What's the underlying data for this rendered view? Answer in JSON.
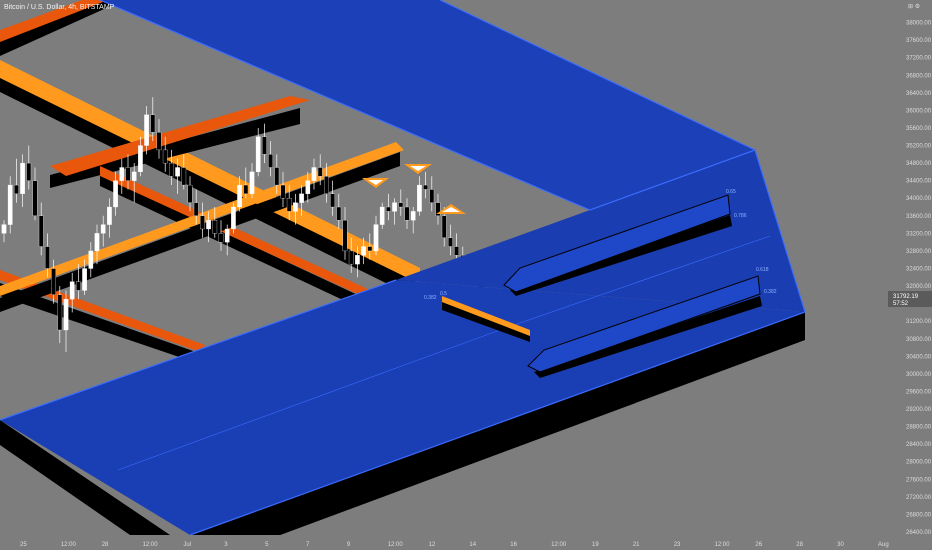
{
  "header": {
    "symbol_title": "Bitcoin / U.S. Dollar, 4h, BITSTAMP",
    "scale_icons": "⊞ ⚙"
  },
  "price_tag": {
    "price": "31792.19",
    "countdown": "57:52"
  },
  "colors": {
    "background": "#7d7d7d",
    "blue_plane": "#1a3fb5",
    "blue_edge": "#3a6cff",
    "orange_light": "#ff9a1f",
    "orange_dark": "#e8570b",
    "shadow": "#000000",
    "candle_up": "#ffffff",
    "candle_down": "#000000"
  },
  "fib_labels": [
    "0.65",
    "0.786",
    "0.618",
    "0.382",
    "0.382",
    "0.5"
  ],
  "icons": [
    "warning-triangle-icon",
    "wedge-arrow-icon"
  ],
  "chart_data": {
    "type": "candlestick",
    "title": "Bitcoin / U.S. Dollar, 4h, BITSTAMP",
    "ylim": [
      26400,
      38400
    ],
    "y_ticks": [
      38000,
      37600,
      37200,
      36800,
      36400,
      36000,
      35600,
      35200,
      34800,
      34400,
      34000,
      33600,
      33200,
      32800,
      32400,
      32000,
      31600,
      31200,
      30800,
      30400,
      30000,
      29600,
      29200,
      28800,
      28400,
      28000,
      27600,
      27200,
      26800,
      26400
    ],
    "x_ticks": [
      "25",
      "12:00",
      "28",
      "12:00",
      "Jul",
      "3",
      "5",
      "7",
      "9",
      "12:00",
      "12",
      "14",
      "16",
      "12:00",
      "19",
      "21",
      "23",
      "12:00",
      "26",
      "28",
      "30",
      "Aug"
    ],
    "last_price": 31792.19,
    "candles": [
      [
        33200,
        33500,
        33000,
        33400
      ],
      [
        33400,
        34500,
        33200,
        34300
      ],
      [
        34300,
        34900,
        33900,
        34100
      ],
      [
        34100,
        35000,
        33800,
        34800
      ],
      [
        34800,
        35200,
        34200,
        34400
      ],
      [
        34400,
        34700,
        33500,
        33600
      ],
      [
        33600,
        33900,
        32700,
        32900
      ],
      [
        32900,
        33200,
        32200,
        32400
      ],
      [
        32400,
        32600,
        31600,
        31800
      ],
      [
        31800,
        32000,
        30700,
        31000
      ],
      [
        31000,
        31900,
        30500,
        31700
      ],
      [
        31700,
        32300,
        31400,
        32100
      ],
      [
        32100,
        32500,
        31700,
        31900
      ],
      [
        31900,
        32600,
        31800,
        32400
      ],
      [
        32400,
        33000,
        32200,
        32800
      ],
      [
        32800,
        33400,
        32500,
        33200
      ],
      [
        33200,
        33600,
        32900,
        33400
      ],
      [
        33400,
        34000,
        33100,
        33800
      ],
      [
        33800,
        34600,
        33600,
        34400
      ],
      [
        34400,
        34900,
        34100,
        34700
      ],
      [
        34700,
        35000,
        34200,
        34400
      ],
      [
        34400,
        34800,
        33900,
        34600
      ],
      [
        34600,
        35400,
        34500,
        35200
      ],
      [
        35200,
        36100,
        35000,
        35900
      ],
      [
        35900,
        36300,
        35300,
        35500
      ],
      [
        35500,
        35800,
        34900,
        35100
      ],
      [
        35100,
        35400,
        34600,
        34800
      ],
      [
        34800,
        35100,
        34300,
        34500
      ],
      [
        34500,
        34900,
        34100,
        34700
      ],
      [
        34700,
        35000,
        34200,
        34300
      ],
      [
        34300,
        34500,
        33700,
        33900
      ],
      [
        33900,
        34200,
        33400,
        33600
      ],
      [
        33600,
        33900,
        33100,
        33300
      ],
      [
        33300,
        33700,
        33000,
        33500
      ],
      [
        33500,
        33800,
        33100,
        33200
      ],
      [
        33200,
        33500,
        32800,
        33000
      ],
      [
        33000,
        33400,
        32700,
        33300
      ],
      [
        33300,
        33900,
        33200,
        33800
      ],
      [
        33800,
        34500,
        33700,
        34300
      ],
      [
        34300,
        34700,
        34000,
        34100
      ],
      [
        34100,
        34800,
        34000,
        34600
      ],
      [
        34600,
        35600,
        34500,
        35400
      ],
      [
        35400,
        35700,
        34800,
        35000
      ],
      [
        35000,
        35300,
        34500,
        34700
      ],
      [
        34700,
        35000,
        34100,
        34300
      ],
      [
        34300,
        34600,
        33800,
        34000
      ],
      [
        34000,
        34300,
        33500,
        33700
      ],
      [
        33700,
        34100,
        33400,
        33900
      ],
      [
        33900,
        34300,
        33600,
        34100
      ],
      [
        34100,
        34600,
        33900,
        34400
      ],
      [
        34400,
        34900,
        34200,
        34700
      ],
      [
        34700,
        35000,
        34300,
        34500
      ],
      [
        34500,
        34800,
        33900,
        34100
      ],
      [
        34100,
        34400,
        33600,
        33800
      ],
      [
        33800,
        34100,
        33300,
        33500
      ],
      [
        33500,
        33800,
        32600,
        32800
      ],
      [
        32800,
        33100,
        32300,
        32500
      ],
      [
        32500,
        32900,
        32200,
        32700
      ],
      [
        32700,
        33100,
        32500,
        32900
      ],
      [
        32900,
        33200,
        32600,
        32800
      ],
      [
        32800,
        33600,
        32700,
        33400
      ],
      [
        33400,
        33900,
        33300,
        33800
      ],
      [
        33800,
        34100,
        33500,
        33700
      ],
      [
        33700,
        34000,
        33400,
        33900
      ],
      [
        33900,
        34200,
        33600,
        33800
      ],
      [
        33800,
        34000,
        33300,
        33500
      ],
      [
        33500,
        33800,
        33200,
        33700
      ],
      [
        33700,
        34500,
        33600,
        34300
      ],
      [
        34300,
        34600,
        34000,
        34200
      ],
      [
        34200,
        34500,
        33700,
        33900
      ],
      [
        33900,
        34100,
        33400,
        33600
      ],
      [
        33600,
        33800,
        32900,
        33100
      ],
      [
        33100,
        33400,
        32700,
        32900
      ],
      [
        32900,
        33200,
        32500,
        32700
      ],
      [
        32700,
        32900,
        32200,
        32400
      ],
      [
        32400,
        32700,
        32000,
        32300
      ],
      [
        32300,
        32600,
        31800,
        32000
      ],
      [
        32000,
        32300,
        31500,
        31700
      ],
      [
        31700,
        32000,
        31300,
        31500
      ],
      [
        31500,
        31800,
        31100,
        31400
      ],
      [
        31400,
        31900,
        31300,
        31792
      ]
    ]
  }
}
